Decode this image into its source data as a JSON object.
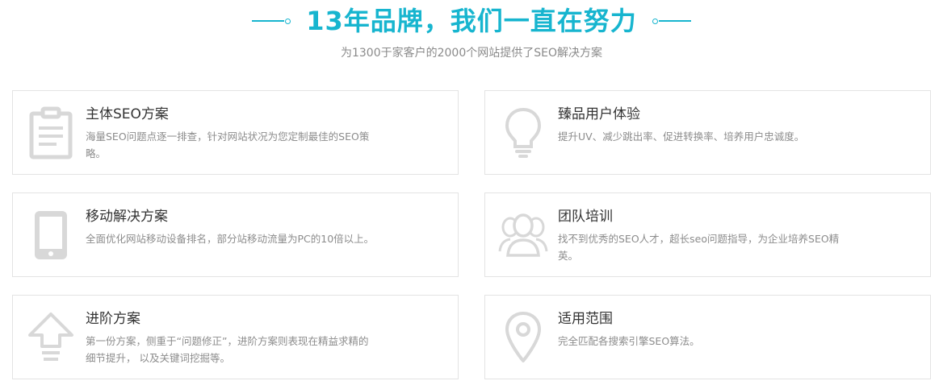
{
  "header": {
    "title": "13年品牌，我们一直在努力",
    "subtitle": "为1300于家客户的2000个网站提供了SEO解决方案"
  },
  "colors": {
    "accent": "#17b5cf",
    "icon": "#d8d8d8",
    "border": "#e3e3e3"
  },
  "cards": [
    {
      "icon": "clipboard-icon",
      "title": "主体SEO方案",
      "desc": "海量SEO问题点逐一排查，针对网站状况为您定制最佳的SEO策略。"
    },
    {
      "icon": "lightbulb-icon",
      "title": "臻品用户体验",
      "desc": "提升UV、减少跳出率、促进转换率、培养用户忠诚度。"
    },
    {
      "icon": "mobile-phone-icon",
      "title": "移动解决方案",
      "desc": "全面优化网站移动设备排名，部分站移动流量为PC的10倍以上。"
    },
    {
      "icon": "team-icon",
      "title": "团队培训",
      "desc": "找不到优秀的SEO人才，超长seo问题指导，为企业培养SEO精英。"
    },
    {
      "icon": "upload-arrow-icon",
      "title": "进阶方案",
      "desc": "第一份方案，侧重于“问题修正”，进阶方案则表现在精益求精的细节提升， 以及关键词挖掘等。"
    },
    {
      "icon": "location-pin-icon",
      "title": "适用范围",
      "desc": "完全匹配各搜索引擎SEO算法。"
    }
  ]
}
